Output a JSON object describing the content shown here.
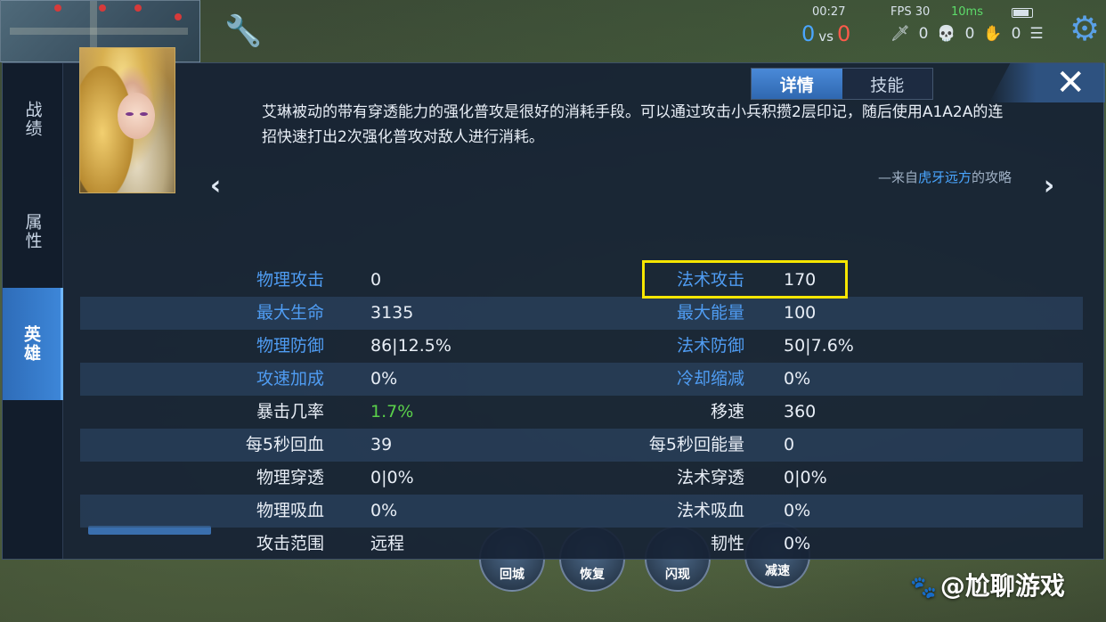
{
  "hud": {
    "time": "00:27",
    "fps": "FPS 30",
    "ping": "10ms",
    "score_blue": "0",
    "vs": "vs",
    "score_red": "0",
    "kills": "0",
    "deaths": "0",
    "assists": "0"
  },
  "side_tabs": [
    {
      "label": "战绩",
      "active": false
    },
    {
      "label": "属性",
      "active": false
    },
    {
      "label": "英雄",
      "active": true
    }
  ],
  "top_tabs": [
    {
      "label": "详情",
      "active": true
    },
    {
      "label": "技能",
      "active": false
    }
  ],
  "close_label": "✕",
  "description": "艾琳被动的带有穿透能力的强化普攻是很好的消耗手段。可以通过攻击小兵积攒2层印记，随后使用A1A2A的连招快速打出2次强化普攻对敌人进行消耗。",
  "credit": {
    "prefix": "—来自",
    "author": "虎牙远方",
    "suffix": "的攻略"
  },
  "stats": [
    {
      "label_left": "物理攻击",
      "value_left": "0",
      "label_right": "法术攻击",
      "value_right": "170"
    },
    {
      "label_left": "最大生命",
      "value_left": "3135",
      "label_right": "最大能量",
      "value_right": "100"
    },
    {
      "label_left": "物理防御",
      "value_left": "86|12.5%",
      "label_right": "法术防御",
      "value_right": "50|7.6%"
    },
    {
      "label_left": "攻速加成",
      "value_left": "0%",
      "label_right": "冷却缩减",
      "value_right": "0%"
    },
    {
      "label_left": "暴击几率",
      "value_left": "1.7%",
      "label_right": "移速",
      "value_right": "360"
    },
    {
      "label_left": "每5秒回血",
      "value_left": "39",
      "label_right": "每5秒回能量",
      "value_right": "0"
    },
    {
      "label_left": "物理穿透",
      "value_left": "0|0%",
      "label_right": "法术穿透",
      "value_right": "0|0%"
    },
    {
      "label_left": "物理吸血",
      "value_left": "0%",
      "label_right": "法术吸血",
      "value_right": "0%"
    },
    {
      "label_left": "攻击范围",
      "value_left": "远程",
      "label_right": "韧性",
      "value_right": "0%"
    }
  ],
  "skills": {
    "recall": "回城",
    "heal": "恢复",
    "flash": "闪现",
    "slow": "减速"
  },
  "watermark": "@尬聊游戏",
  "colors": {
    "highlight": "#f6e600",
    "accent_blue": "#4f9cf2",
    "crit_green": "#5ad04a"
  }
}
